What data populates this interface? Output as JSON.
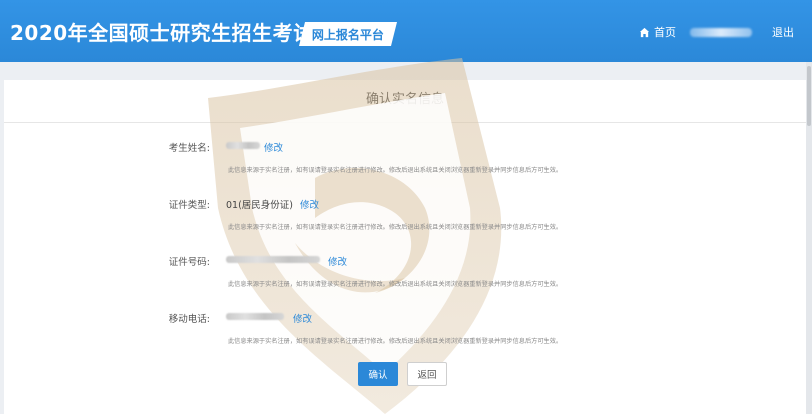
{
  "header": {
    "title": "2020年全国硕士研究生招生考试",
    "platform_badge": "网上报名平台",
    "home_label": "首页",
    "logout_label": "退出"
  },
  "card": {
    "title": "确认实名信息"
  },
  "rows": [
    {
      "label": "考生姓名:",
      "value": "",
      "edit_label": "修改",
      "note": "此信息来源于实名注册，如有误请登录实名注册进行修改。修改后退出系统且关闭浏览器重新登录并同步信息后方可生效。"
    },
    {
      "label": "证件类型:",
      "value": "01(居民身份证)",
      "edit_label": "修改",
      "note": "此信息来源于实名注册，如有误请登录实名注册进行修改。修改后退出系统且关闭浏览器重新登录并同步信息后方可生效。"
    },
    {
      "label": "证件号码:",
      "value": "",
      "edit_label": "修改",
      "note": "此信息来源于实名注册，如有误请登录实名注册进行修改。修改后退出系统且关闭浏览器重新登录并同步信息后方可生效。"
    },
    {
      "label": "移动电话:",
      "value": "",
      "edit_label": "修改",
      "note": "此信息来源于实名注册，如有误请登录实名注册进行修改。修改后退出系统且关闭浏览器重新登录并同步信息后方可生效。"
    }
  ],
  "buttons": {
    "confirm_label": "确认",
    "back_label": "返回"
  },
  "colors": {
    "header_bg": "#2b88d8",
    "link": "#2b88d8",
    "page_bg": "#eceff3",
    "watermark": "#d8c3a5"
  },
  "icons": {
    "home": "home-icon",
    "watermark": "shield-watermark"
  }
}
